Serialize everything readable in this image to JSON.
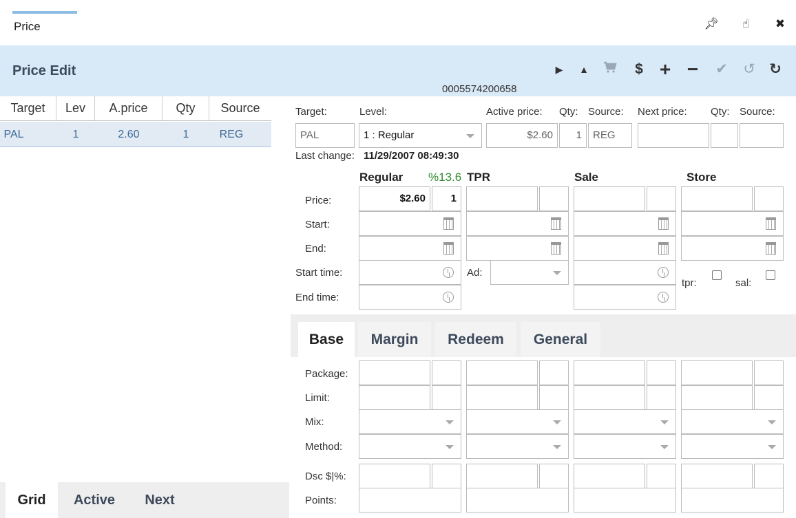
{
  "window": {
    "title": "Price",
    "icons": [
      "pin-icon",
      "hand-pointer-icon",
      "close-icon"
    ]
  },
  "header": {
    "title": "Price Edit",
    "item_code": "0005574200658",
    "toolbar_icons": [
      "play-icon",
      "triangle-up-icon",
      "cart-icon",
      "dollar-icon",
      "plus-icon",
      "minus-icon",
      "check-icon",
      "undo-icon",
      "refresh-icon"
    ]
  },
  "grid": {
    "columns": [
      "Target",
      "Lev",
      "A.price",
      "Qty",
      "Source"
    ],
    "rows": [
      {
        "target": "PAL",
        "lev": "1",
        "aprice": "2.60",
        "qty": "1",
        "source": "REG"
      }
    ]
  },
  "left_tabs": [
    "Grid",
    "Active",
    "Next"
  ],
  "top_form": {
    "labels": {
      "target": "Target:",
      "level": "Level:",
      "active_price": "Active price:",
      "qty": "Qty:",
      "source": "Source:",
      "next_price": "Next price:",
      "next_qty": "Qty:",
      "next_source": "Source:"
    },
    "target": "PAL",
    "level": "1 : Regular",
    "active_price": "$2.60",
    "active_qty": "1",
    "active_source": "REG",
    "next_price": "",
    "next_qty": "",
    "next_source": "",
    "last_change_label": "Last change:",
    "last_change": "11/29/2007 08:49:30"
  },
  "price_grid": {
    "columns": {
      "regular": "Regular",
      "margin": "%13.6",
      "tpr": "TPR",
      "sale": "Sale",
      "store": "Store"
    },
    "row_labels": {
      "price": "Price:",
      "start": "Start:",
      "end": "End:",
      "start_time": "Start time:",
      "end_time": "End time:"
    },
    "regular_price": "$2.60",
    "regular_qty": "1",
    "ad_label": "Ad:",
    "tpr_label": "tpr:",
    "sal_label": "sal:"
  },
  "detail_tabs": [
    "Base",
    "Margin",
    "Redeem",
    "General"
  ],
  "detail_rows": {
    "package": "Package:",
    "limit": "Limit:",
    "mix": "Mix:",
    "method": "Method:",
    "dsc": "Dsc $|%:",
    "points": "Points:"
  },
  "colors": {
    "header_bg": "#d8e9f7",
    "selected_row": "#e2ebf4",
    "margin_green": "#2e8b2e",
    "link_blue": "#3e6a96"
  }
}
